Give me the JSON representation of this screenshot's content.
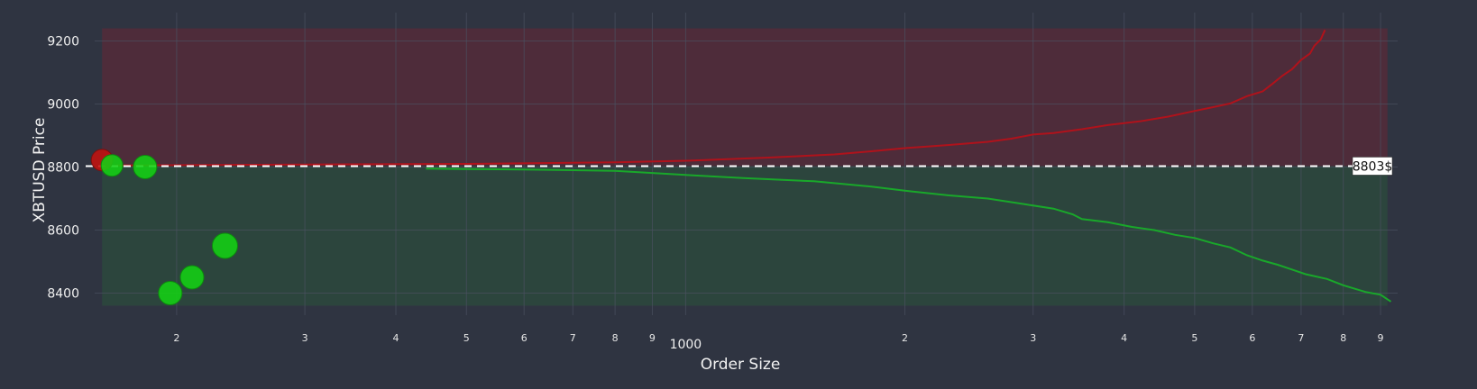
{
  "chart_data": {
    "type": "scatter",
    "title": "",
    "xlabel": "Order Size",
    "ylabel": "XBTUSD Price",
    "x_scale": "log",
    "xlim": [
      150,
      9500
    ],
    "ylim": [
      8330,
      9290
    ],
    "x_ticks": [
      {
        "value": 200,
        "label": "2"
      },
      {
        "value": 300,
        "label": "3"
      },
      {
        "value": 400,
        "label": "4"
      },
      {
        "value": 500,
        "label": "5"
      },
      {
        "value": 600,
        "label": "6"
      },
      {
        "value": 700,
        "label": "7"
      },
      {
        "value": 800,
        "label": "8"
      },
      {
        "value": 900,
        "label": "9"
      },
      {
        "value": 1000,
        "label": "1000"
      },
      {
        "value": 2000,
        "label": "2"
      },
      {
        "value": 3000,
        "label": "3"
      },
      {
        "value": 4000,
        "label": "4"
      },
      {
        "value": 5000,
        "label": "5"
      },
      {
        "value": 6000,
        "label": "6"
      },
      {
        "value": 7000,
        "label": "7"
      },
      {
        "value": 8000,
        "label": "8"
      },
      {
        "value": 9000,
        "label": "9"
      }
    ],
    "y_ticks": [
      8400,
      8600,
      8800,
      9000,
      9200
    ],
    "grid": true,
    "colors": {
      "ask": "#b0121b",
      "bid": "#19a82a",
      "ask_fill": "#5a2a38",
      "bid_fill": "#2c4a3c",
      "bid_bubble": "#13d113",
      "ask_bubble": "#c4120f",
      "grid": "#4a5060",
      "mid_line": "#ffffff"
    },
    "bands": [
      {
        "name": "ask",
        "x": [
          158,
          9200
        ],
        "y": [
          8803,
          9240
        ]
      },
      {
        "name": "bid",
        "x": [
          158,
          9200
        ],
        "y": [
          8360,
          8803
        ]
      }
    ],
    "mid_price": {
      "value": 8803,
      "label": "8803$"
    },
    "series": [
      {
        "kind": "ask-line",
        "points": [
          [
            165,
            8805
          ],
          [
            300,
            8808
          ],
          [
            500,
            8810
          ],
          [
            800,
            8815
          ],
          [
            1000,
            8820
          ],
          [
            1300,
            8830
          ],
          [
            1600,
            8840
          ],
          [
            1800,
            8850
          ],
          [
            2000,
            8860
          ],
          [
            2300,
            8870
          ],
          [
            2600,
            8880
          ],
          [
            2800,
            8890
          ],
          [
            3000,
            8903
          ],
          [
            3200,
            8908
          ],
          [
            3500,
            8920
          ],
          [
            3800,
            8933
          ],
          [
            4200,
            8945
          ],
          [
            4600,
            8960
          ],
          [
            5000,
            8978
          ],
          [
            5300,
            8990
          ],
          [
            5600,
            9002
          ],
          [
            5900,
            9025
          ],
          [
            6200,
            9040
          ],
          [
            6400,
            9065
          ],
          [
            6600,
            9090
          ],
          [
            6800,
            9110
          ],
          [
            7000,
            9140
          ],
          [
            7200,
            9160
          ],
          [
            7300,
            9185
          ],
          [
            7450,
            9205
          ],
          [
            7550,
            9235
          ]
        ]
      },
      {
        "kind": "bid-line",
        "points": [
          [
            440,
            8795
          ],
          [
            600,
            8792
          ],
          [
            800,
            8788
          ],
          [
            1000,
            8775
          ],
          [
            1200,
            8765
          ],
          [
            1500,
            8755
          ],
          [
            1800,
            8738
          ],
          [
            2000,
            8725
          ],
          [
            2300,
            8710
          ],
          [
            2600,
            8700
          ],
          [
            2900,
            8683
          ],
          [
            3200,
            8668
          ],
          [
            3400,
            8650
          ],
          [
            3500,
            8635
          ],
          [
            3800,
            8625
          ],
          [
            4100,
            8610
          ],
          [
            4400,
            8600
          ],
          [
            4700,
            8585
          ],
          [
            5000,
            8575
          ],
          [
            5300,
            8558
          ],
          [
            5600,
            8545
          ],
          [
            5900,
            8520
          ],
          [
            6200,
            8503
          ],
          [
            6500,
            8490
          ],
          [
            6800,
            8475
          ],
          [
            7100,
            8460
          ],
          [
            7600,
            8445
          ],
          [
            8000,
            8425
          ],
          [
            8600,
            8403
          ],
          [
            9000,
            8395
          ],
          [
            9300,
            8373
          ]
        ]
      }
    ],
    "bubbles": [
      {
        "side": "ask",
        "size": 158,
        "price": 8822,
        "radius": 12
      },
      {
        "side": "bid",
        "size": 163,
        "price": 8805,
        "radius": 12
      },
      {
        "side": "bid",
        "size": 181,
        "price": 8800,
        "radius": 13
      },
      {
        "side": "bid",
        "size": 196,
        "price": 8400,
        "radius": 13
      },
      {
        "side": "bid",
        "size": 210,
        "price": 8450,
        "radius": 13
      },
      {
        "side": "bid",
        "size": 233,
        "price": 8550,
        "radius": 14
      }
    ]
  }
}
